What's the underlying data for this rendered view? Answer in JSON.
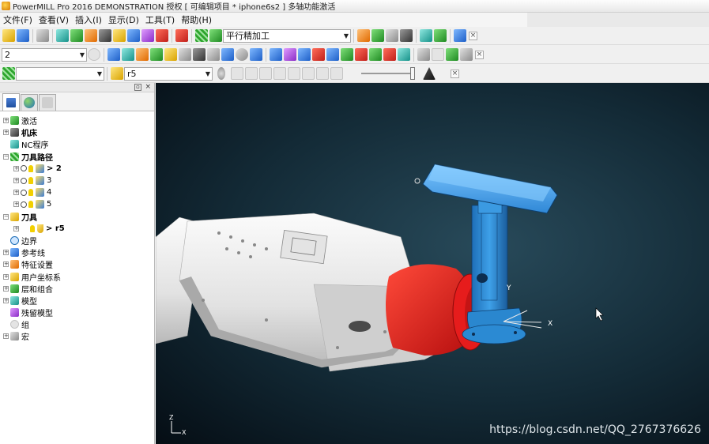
{
  "window": {
    "title": "PowerMILL Pro 2016 DEMONSTRATION 授权    [ 可编辑项目 * iphone6s2 ]    多轴功能激活"
  },
  "menu": [
    "文件(F)",
    "查看(V)",
    "插入(I)",
    "显示(D)",
    "工具(T)",
    "帮助(H)"
  ],
  "toolbar1": {
    "strategy_value": "平行精加工"
  },
  "toolbar2": {
    "level_value": "2"
  },
  "toolbar3": {
    "tool_value": "r5",
    "blank_value": ""
  },
  "tree": {
    "items": [
      {
        "label": "激活",
        "bold": false
      },
      {
        "label": "机床",
        "bold": true
      },
      {
        "label": "NC程序",
        "bold": false
      },
      {
        "label": "刀具路径",
        "bold": true
      },
      {
        "label": "> 2",
        "bold": true
      },
      {
        "label": "3",
        "bold": false
      },
      {
        "label": "4",
        "bold": false
      },
      {
        "label": "5",
        "bold": false
      },
      {
        "label": "刀具",
        "bold": true
      },
      {
        "label": "> r5",
        "bold": true
      },
      {
        "label": "边界",
        "bold": false
      },
      {
        "label": "参考线",
        "bold": false
      },
      {
        "label": "特征设置",
        "bold": false
      },
      {
        "label": "用户坐标系",
        "bold": false
      },
      {
        "label": "层和组合",
        "bold": false
      },
      {
        "label": "模型",
        "bold": false
      },
      {
        "label": "残留模型",
        "bold": false
      },
      {
        "label": "组",
        "bold": false
      },
      {
        "label": "宏",
        "bold": false
      }
    ]
  },
  "viewport": {
    "axis_y": "Y",
    "axis_x": "X",
    "triad_z": "Z",
    "triad_x": "X",
    "watermark": "https://blog.csdn.net/QQ_2767376626"
  },
  "colors": {
    "robot_red": "#e01818",
    "fixture_blue": "#2e8fd6",
    "phone_blue": "#4aa8ec",
    "robot_white": "#e9e9e9"
  }
}
